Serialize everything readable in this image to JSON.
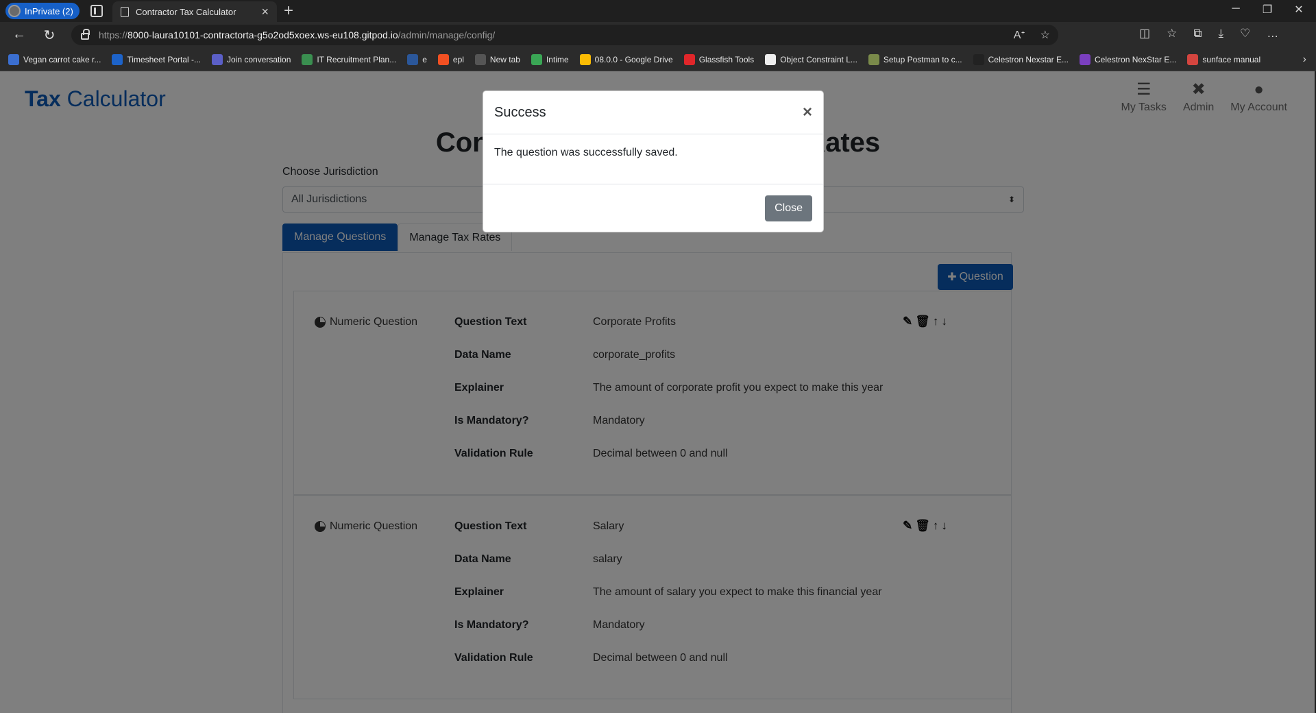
{
  "browser": {
    "inprivate_label": "InPrivate (2)",
    "tab_title": "Contractor Tax Calculator",
    "url_proto": "https://",
    "url_host": "8000-laura10101-contractorta-g5o2od5xoex.ws-eu108.gitpod.io",
    "url_path": "/admin/manage/config/",
    "bookmarks": [
      {
        "label": "Vegan carrot cake r...",
        "color": "#3b6fd1"
      },
      {
        "label": "Timesheet Portal -...",
        "color": "#1d63c9"
      },
      {
        "label": "Join conversation",
        "color": "#5b5fc7"
      },
      {
        "label": "IT Recruitment Plan...",
        "color": "#3a8f50"
      },
      {
        "label": "e",
        "color": "#2b579a"
      },
      {
        "label": "epl",
        "color": "#f25022"
      },
      {
        "label": "New tab",
        "color": "#555555"
      },
      {
        "label": "Intime",
        "color": "#3aa655"
      },
      {
        "label": "08.0.0 - Google Drive",
        "color": "#fbbc04"
      },
      {
        "label": "Glassfish Tools",
        "color": "#e0262a"
      },
      {
        "label": "Object Constraint L...",
        "color": "#eeeeee"
      },
      {
        "label": "Setup Postman to c...",
        "color": "#7a8a4a"
      },
      {
        "label": "Celestron Nexstar E...",
        "color": "#222222"
      },
      {
        "label": "Celestron NexStar E...",
        "color": "#7a3fbf"
      },
      {
        "label": "sunface manual",
        "color": "#d4453f"
      }
    ]
  },
  "app": {
    "brand_part1": "Tax",
    "brand_part2": "Calculator",
    "nav": [
      {
        "label": "My Tasks",
        "icon": "list-icon"
      },
      {
        "label": "Admin",
        "icon": "tools-icon"
      },
      {
        "label": "My Account",
        "icon": "user-icon"
      }
    ],
    "page_title": "Contractor Questions & Tax Rates",
    "jurisdiction_label": "Choose Jurisdiction",
    "jurisdiction_value": "All Jurisdictions",
    "tabs": [
      "Manage Questions",
      "Manage Tax Rates"
    ],
    "add_question_label": "Question",
    "field_labels": {
      "question_text": "Question Text",
      "data_name": "Data Name",
      "explainer": "Explainer",
      "is_mandatory": "Is Mandatory?",
      "validation_rule": "Validation Rule"
    },
    "questions": [
      {
        "type": "Numeric Question",
        "question_text": "Corporate Profits",
        "data_name": "corporate_profits",
        "explainer": "The amount of corporate profit you expect to make this year",
        "is_mandatory": "Mandatory",
        "validation_rule": "Decimal between 0 and null"
      },
      {
        "type": "Numeric Question",
        "question_text": "Salary",
        "data_name": "salary",
        "explainer": "The amount of salary you expect to make this financial year",
        "is_mandatory": "Mandatory",
        "validation_rule": "Decimal between 0 and null"
      }
    ]
  },
  "modal": {
    "title": "Success",
    "body": "The question was successfully saved.",
    "close_label": "Close"
  },
  "colors": {
    "brand": "#0d5bb8",
    "secondary_button": "#6c757d"
  }
}
